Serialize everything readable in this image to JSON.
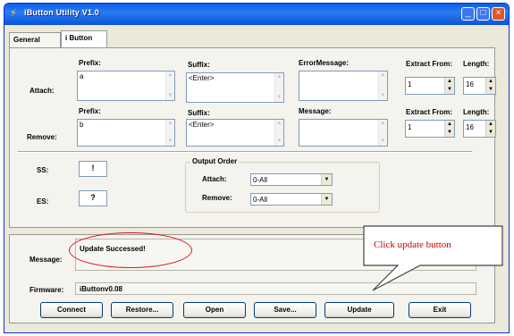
{
  "window": {
    "title": "iButton Utility V1.0",
    "icon": "app-icon"
  },
  "tabs": [
    {
      "label": "General"
    },
    {
      "label": "i Button"
    }
  ],
  "attach": {
    "row_label": "Attach:",
    "prefix_label": "Prefix:",
    "prefix_value": "a",
    "suffix_label": "Suffix:",
    "suffix_value": "<Enter>",
    "message_label": "ErrorMessage:",
    "message_value": "",
    "extract_label": "Extract From:",
    "extract_value": "1",
    "length_label": "Length:",
    "length_value": "16"
  },
  "remove": {
    "row_label": "Remove:",
    "prefix_label": "Prefix:",
    "prefix_value": "b",
    "suffix_label": "Suffix:",
    "suffix_value": "<Enter>",
    "message_label": "Message:",
    "message_value": "",
    "extract_label": "Extract From:",
    "extract_value": "1",
    "length_label": "Length:",
    "length_value": "16"
  },
  "ss": {
    "label": "SS:",
    "value": "!"
  },
  "es": {
    "label": "ES:",
    "value": "?"
  },
  "output_order": {
    "title": "Output Order",
    "attach_label": "Attach:",
    "attach_value": "0-All",
    "remove_label": "Remove:",
    "remove_value": "0-All"
  },
  "status": {
    "message_label": "Message:",
    "message_value": "Update Successed!",
    "firmware_label": "Firmware:",
    "firmware_value": "iButtonv0.08"
  },
  "buttons": {
    "connect": "Connect",
    "restore": "Restore...",
    "open": "Open",
    "save": "Save...",
    "update": "Update",
    "exit": "Exit"
  },
  "annotation": {
    "callout_text": "Click update button",
    "highlight_color": "#dd1111"
  },
  "colors": {
    "titlebar": "#0a5fe8",
    "window_bg": "#ece9d8",
    "callout_text": "#cc0000"
  }
}
